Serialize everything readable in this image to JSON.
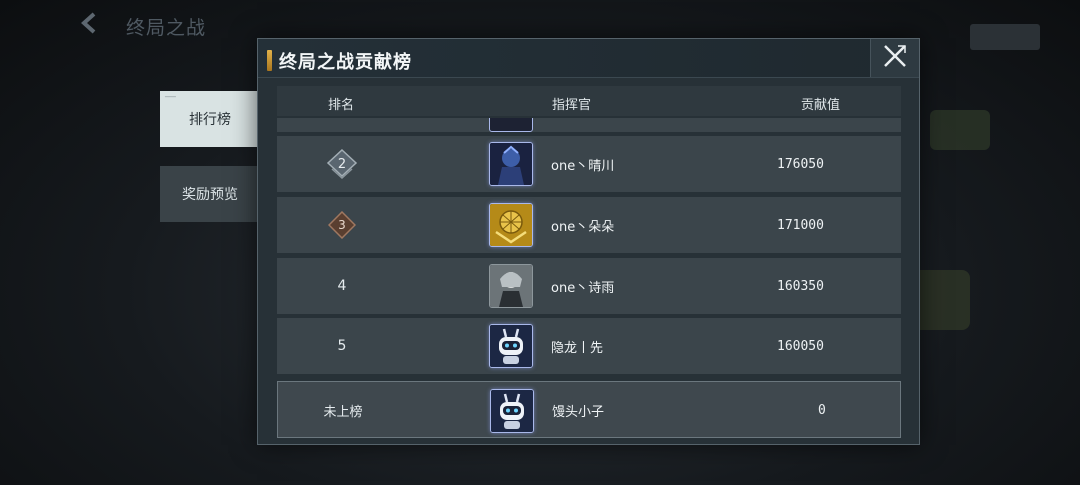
{
  "background": {
    "back_icon": "back-arrow-icon",
    "title": "终局之战"
  },
  "modal": {
    "title": "终局之战贡献榜",
    "close_icon": "close-icon"
  },
  "tabs": [
    {
      "label": "排行榜",
      "active": true
    },
    {
      "label": "奖励预览",
      "active": false
    }
  ],
  "table": {
    "headers": {
      "rank": "排名",
      "commander": "指挥官",
      "contribution": "贡献值"
    },
    "rows": [
      {
        "rank": "2",
        "rank_style": "silver-badge",
        "avatar": "dark-armor-avatar-icon",
        "name": "one丶晴川",
        "score": "176050"
      },
      {
        "rank": "3",
        "rank_style": "bronze-badge",
        "avatar": "gold-emblem-avatar-icon",
        "name": "one丶朵朵",
        "score": "171000"
      },
      {
        "rank": "4",
        "rank_style": "plain",
        "avatar": "character-portrait-avatar-icon",
        "name": "one丶诗雨",
        "score": "160350"
      },
      {
        "rank": "5",
        "rank_style": "plain",
        "avatar": "robot-avatar-icon",
        "name": "隐龙丨先",
        "score": "160050"
      }
    ],
    "mine": {
      "rank": "未上榜",
      "avatar": "robot-avatar-icon",
      "name": "馒头小子",
      "score": "0"
    }
  },
  "colors": {
    "accent_gold": "#e2b24a",
    "panel": "#273137",
    "row": "#3b454b",
    "tab_active": "#d9e3e3"
  }
}
